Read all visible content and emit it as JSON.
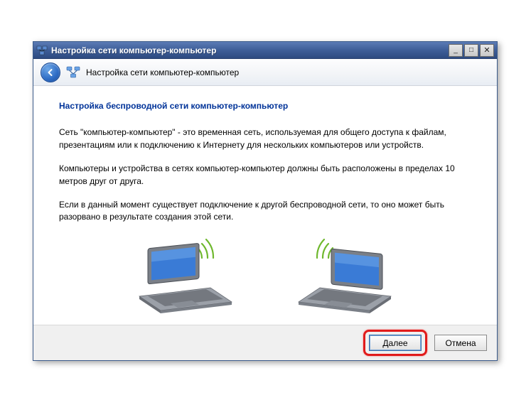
{
  "window": {
    "title": "Настройка сети компьютер-компьютер"
  },
  "header": {
    "title": "Настройка сети компьютер-компьютер"
  },
  "content": {
    "heading": "Настройка беспроводной сети компьютер-компьютер",
    "p1": "Сеть \"компьютер-компьютер\" - это временная сеть, используемая для общего доступа к файлам, презентациям или к подключению к Интернету для нескольких компьютеров или устройств.",
    "p2": "Компьютеры и устройства в сетях компьютер-компьютер должны быть расположены в пределах 10 метров друг от друга.",
    "p3": "Если в данный момент существует подключение к другой беспроводной сети, то оно может быть разорвано в результате создания этой сети."
  },
  "footer": {
    "next_label": "Далее",
    "cancel_label": "Отмена"
  },
  "icons": {
    "minimize": "_",
    "maximize": "□",
    "close": "✕"
  }
}
